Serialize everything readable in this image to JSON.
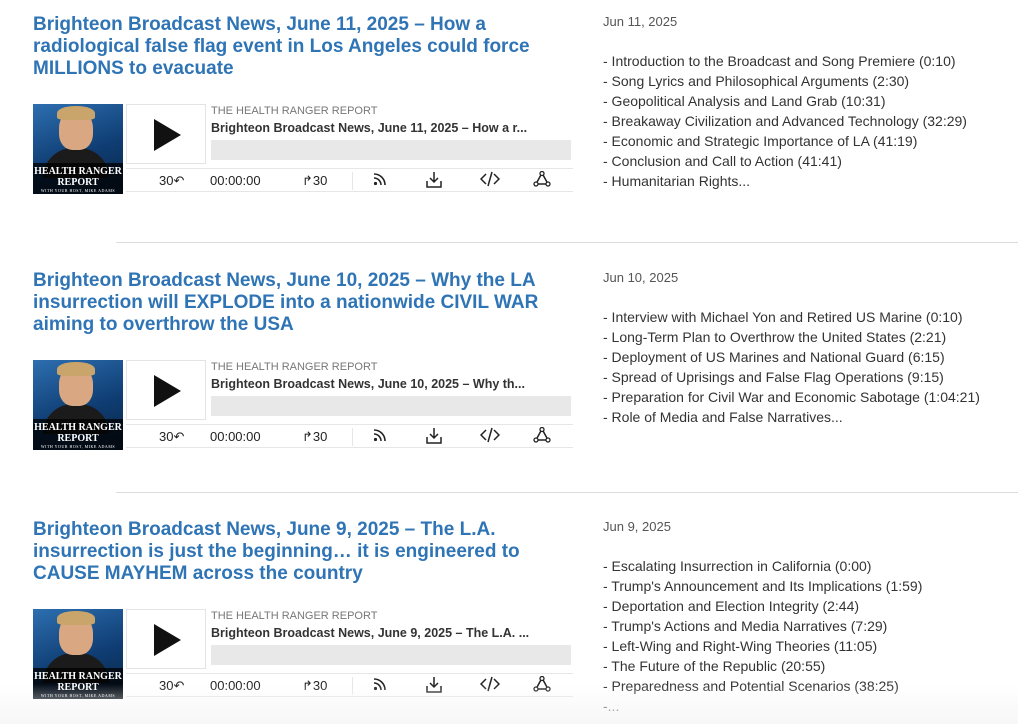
{
  "episodes": [
    {
      "title": "Brighteon Broadcast News, June 11, 2025 – How a radiological false flag event in Los Angeles could force MILLIONS to evacuate",
      "cover_text": "HEALTH RANGER REPORT",
      "cover_subtext": "WITH YOUR HOST, MIKE ADAMS",
      "show_name": "THE HEALTH RANGER REPORT",
      "track_title": "Brighteon Broadcast News, June 11, 2025 – How a r...",
      "rewind_label": "30↶",
      "time": "00:00:00",
      "forward_label": "↱30",
      "date": "Jun 11, 2025",
      "topics": [
        "- Introduction to the Broadcast and Song Premiere (0:10)",
        "- Song Lyrics and Philosophical Arguments (2:30)",
        "- Geopolitical Analysis and Land Grab (10:31)",
        "- Breakaway Civilization and Advanced Technology (32:29)",
        "- Economic and Strategic Importance of LA (41:19)",
        "- Conclusion and Call to Action (41:41)",
        "- Humanitarian Rights..."
      ]
    },
    {
      "title": "Brighteon Broadcast News, June 10, 2025 – Why the LA insurrection will EXPLODE into a nationwide CIVIL WAR aiming to overthrow the USA",
      "cover_text": "HEALTH RANGER REPORT",
      "cover_subtext": "WITH YOUR HOST, MIKE ADAMS",
      "show_name": "THE HEALTH RANGER REPORT",
      "track_title": "Brighteon Broadcast News, June 10, 2025 – Why th...",
      "rewind_label": "30↶",
      "time": "00:00:00",
      "forward_label": "↱30",
      "date": "Jun 10, 2025",
      "topics": [
        "- Interview with Michael Yon and Retired US Marine (0:10)",
        "- Long-Term Plan to Overthrow the United States (2:21)",
        "- Deployment of US Marines and National Guard (6:15)",
        "- Spread of Uprisings and False Flag Operations (9:15)",
        "- Preparation for Civil War and Economic Sabotage (1:04:21)",
        "- Role of Media and False Narratives..."
      ]
    },
    {
      "title": "Brighteon Broadcast News, June 9, 2025 – The L.A. insurrection is just the beginning… it is engineered to CAUSE MAYHEM across the country",
      "cover_text": "HEALTH RANGER REPORT",
      "cover_subtext": "WITH YOUR HOST, MIKE ADAMS",
      "show_name": "THE HEALTH RANGER REPORT",
      "track_title": "Brighteon Broadcast News, June 9, 2025 – The L.A. ...",
      "rewind_label": "30↶",
      "time": "00:00:00",
      "forward_label": "↱30",
      "date": "Jun 9, 2025",
      "topics": [
        "- Escalating Insurrection in California (0:00)",
        "- Trump's Announcement and Its Implications (1:59)",
        "- Deportation and Election Integrity (2:44)",
        "- Trump's Actions and Media Narratives (7:29)",
        "- Left-Wing and Right-Wing Theories (11:05)",
        "- The Future of the Republic (20:55)",
        "- Preparedness and Potential Scenarios (38:25)",
        "-..."
      ]
    }
  ],
  "icons": [
    "rss-icon",
    "download-icon",
    "embed-code-icon",
    "share-icon"
  ],
  "colors": {
    "title_link": "#2f74b5",
    "progress_bg": "#e8e8e8"
  }
}
